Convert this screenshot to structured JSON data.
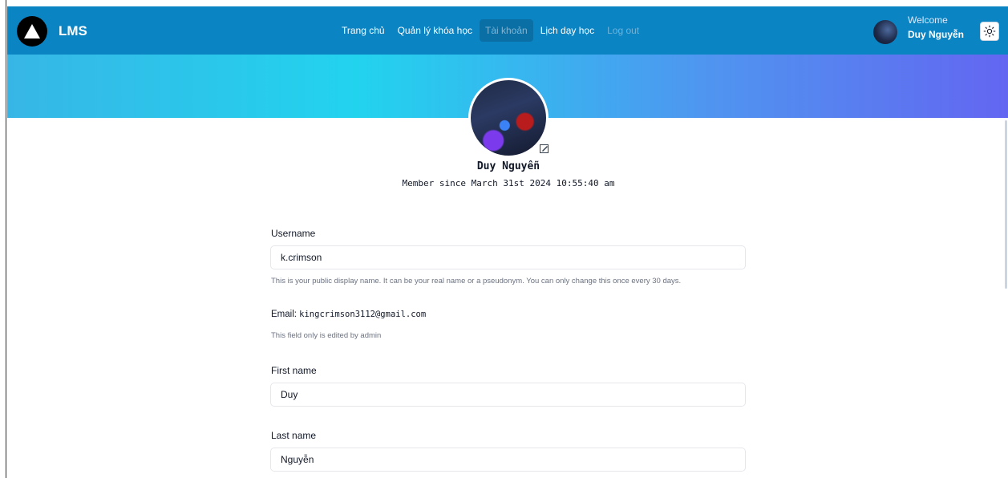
{
  "navbar": {
    "brand": "LMS",
    "links": [
      {
        "label": "Trang chủ",
        "active": false
      },
      {
        "label": "Quản lý khóa học",
        "active": false
      },
      {
        "label": "Tài khoản",
        "active": true
      },
      {
        "label": "Lịch dạy học",
        "active": false
      },
      {
        "label": "Log out",
        "active": false
      }
    ],
    "welcome_label": "Welcome",
    "user_name": "Duy Nguyễn",
    "theme_icon": "sun-icon"
  },
  "colors": {
    "navbar_bg": "#0b84c4",
    "banner_start": "#37b6e6",
    "banner_mid": "#22d3ee",
    "banner_end": "#6366f1"
  },
  "profile": {
    "name": "Duy Nguyễn",
    "member_since": "Member since March 31st 2024 10:55:40 am"
  },
  "form": {
    "username": {
      "label": "Username",
      "value": "k.crimson",
      "help": "This is your public display name. It can be your real name or a pseudonym. You can only change this once every 30 days."
    },
    "email": {
      "label": "Email:",
      "value": "kingcrimson3112@gmail.com",
      "help": "This field only is edited by admin"
    },
    "first_name": {
      "label": "First name",
      "value": "Duy"
    },
    "last_name": {
      "label": "Last name",
      "value": "Nguyễn"
    }
  }
}
